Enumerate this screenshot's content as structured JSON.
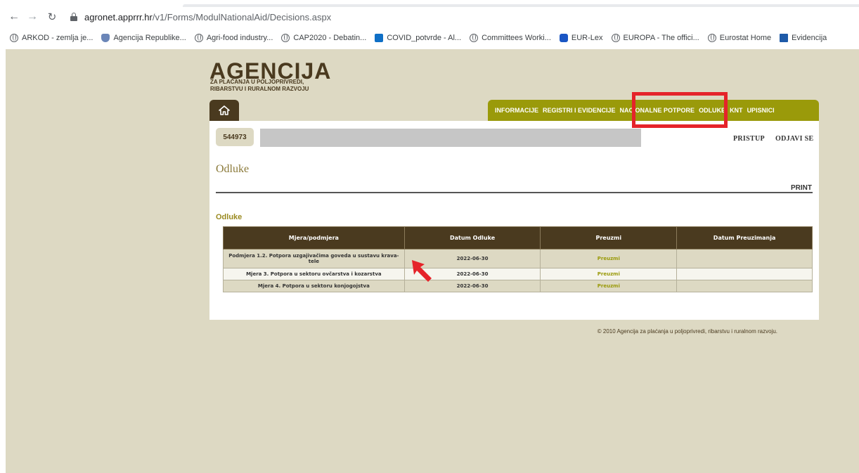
{
  "browser": {
    "url_host": "agronet.apprrr.hr",
    "url_path": "/v1/Forms/ModulNationalAid/Decisions.aspx",
    "bookmarks": [
      {
        "label": "ARKOD - zemlja je...",
        "icon": "globe"
      },
      {
        "label": "Agencija Republike...",
        "icon": "shield"
      },
      {
        "label": "Agri-food industry...",
        "icon": "globe"
      },
      {
        "label": "CAP2020 - Debatin...",
        "icon": "globe"
      },
      {
        "label": "COVID_potvrde - Al...",
        "icon": "sp"
      },
      {
        "label": "Committees Worki...",
        "icon": "globe"
      },
      {
        "label": "EUR-Lex",
        "icon": "chat"
      },
      {
        "label": "EUROPA - The offici...",
        "icon": "globe"
      },
      {
        "label": "Eurostat Home",
        "icon": "globe"
      },
      {
        "label": "Evidencija",
        "icon": "grid"
      }
    ]
  },
  "logo": {
    "title": "AGENCIJA",
    "subtitle_line1": "ZA PLAĆANJA U POLJOPRIVREDI,",
    "subtitle_line2": "RIBARSTVU I RURALNOM RAZVOJU"
  },
  "menu": [
    "INFORMACIJE",
    "REGISTRI I EVIDENCIJE",
    "NACIONALNE POTPORE",
    "ODLUKE",
    "KNT",
    "UPISNICI"
  ],
  "user": {
    "id": "544973",
    "pristup": "PRISTUP",
    "odjavi": "ODJAVI SE"
  },
  "page_heading": "Odluke",
  "print_label": "PRINT",
  "section_title": "Odluke",
  "table": {
    "headers": [
      "Mjera/podmjera",
      "Datum Odluke",
      "Preuzmi",
      "Datum Preuzimanja"
    ],
    "rows": [
      {
        "mjera": "Podmjera 1.2. Potpora uzgajivačima goveda u sustavu krava-tele",
        "datum": "2022-06-30",
        "preuzmi": "Preuzmi",
        "datum_preuzimanja": ""
      },
      {
        "mjera": "Mjera 3. Potpora u sektoru ovčarstva i kozarstva",
        "datum": "2022-06-30",
        "preuzmi": "Preuzmi",
        "datum_preuzimanja": ""
      },
      {
        "mjera": "Mjera 4. Potpora u sektoru konjogojstva",
        "datum": "2022-06-30",
        "preuzmi": "Preuzmi",
        "datum_preuzimanja": ""
      }
    ]
  },
  "footer": "© 2010 Agencija za plaćanja u poljoprivredi, ribarstvu i ruralnom razvoju.",
  "colors": {
    "page_bg": "#ddd9c3",
    "brand_dark": "#4a3a1f",
    "menu_olive": "#9a9a0a",
    "highlight_red": "#e5232a"
  }
}
